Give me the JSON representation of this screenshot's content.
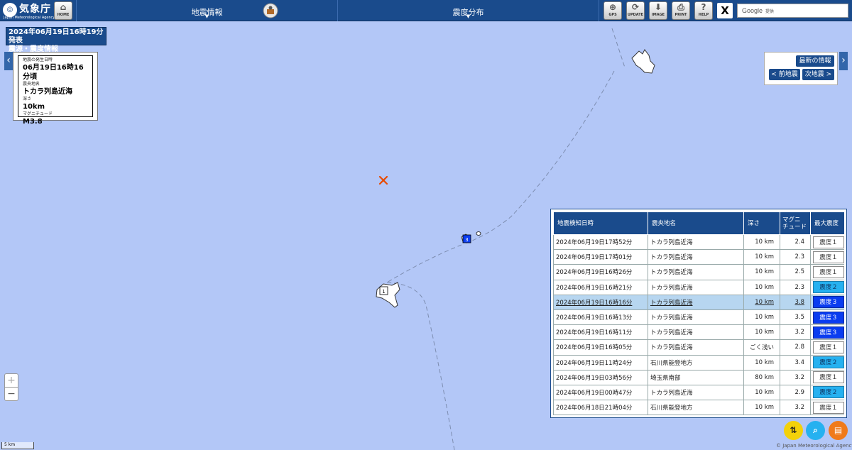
{
  "header": {
    "logo_name": "気象庁",
    "logo_sub": "Japan Meteorological Agency",
    "home_label": "HOME",
    "menu_quake": "地震情報",
    "menu_intensity": "震度分布",
    "tools": [
      "GPS",
      "UPDATE",
      "IMAGE",
      "PRINT",
      "HELP"
    ],
    "x_label": "X",
    "search_brand": "Google",
    "search_provider": "提供"
  },
  "title": {
    "line1": "2024年06月19日16時19分発表",
    "line2": "震源・震度情報"
  },
  "quake": {
    "time_label": "地震の発生日時",
    "time": "06月19日16時16分頃",
    "epicenter_label": "震央地名",
    "epicenter": "トカラ列島近海",
    "depth_label": "深さ",
    "depth": "10km",
    "magnitude_label": "マグニチュード",
    "magnitude": "M3.8"
  },
  "nav": {
    "latest": "最新の情報",
    "prev": "< 前地震",
    "next": "次地震 >"
  },
  "map": {
    "station_3": "3",
    "station_1": "1"
  },
  "zoom": {
    "in": "+",
    "out": "−"
  },
  "scale": "5 km",
  "copyright": "© Japan Meteorological Agency",
  "table": {
    "headers": [
      "地震検知日時",
      "震央地名",
      "深さ",
      "マグニ\nチュード",
      "最大震度"
    ],
    "rows": [
      {
        "time": "2024年06月19日17時52分",
        "place": "トカラ列島近海",
        "depth": "10 km",
        "mag": "2.4",
        "int": "震度１",
        "lvl": 1
      },
      {
        "time": "2024年06月19日17時01分",
        "place": "トカラ列島近海",
        "depth": "10 km",
        "mag": "2.3",
        "int": "震度１",
        "lvl": 1
      },
      {
        "time": "2024年06月19日16時26分",
        "place": "トカラ列島近海",
        "depth": "10 km",
        "mag": "2.5",
        "int": "震度１",
        "lvl": 1
      },
      {
        "time": "2024年06月19日16時21分",
        "place": "トカラ列島近海",
        "depth": "10 km",
        "mag": "2.3",
        "int": "震度２",
        "lvl": 2
      },
      {
        "time": "2024年06月19日16時16分",
        "place": "トカラ列島近海",
        "depth": "10 km",
        "mag": "3.8",
        "int": "震度３",
        "lvl": 3,
        "selected": true
      },
      {
        "time": "2024年06月19日16時13分",
        "place": "トカラ列島近海",
        "depth": "10 km",
        "mag": "3.5",
        "int": "震度３",
        "lvl": 3
      },
      {
        "time": "2024年06月19日16時11分",
        "place": "トカラ列島近海",
        "depth": "10 km",
        "mag": "3.2",
        "int": "震度３",
        "lvl": 3
      },
      {
        "time": "2024年06月19日16時05分",
        "place": "トカラ列島近海",
        "depth": "ごく浅い",
        "mag": "2.8",
        "int": "震度１",
        "lvl": 1
      },
      {
        "time": "2024年06月19日11時24分",
        "place": "石川県能登地方",
        "depth": "10 km",
        "mag": "3.4",
        "int": "震度２",
        "lvl": 2
      },
      {
        "time": "2024年06月19日03時56分",
        "place": "埼玉県南部",
        "depth": "80 km",
        "mag": "3.2",
        "int": "震度１",
        "lvl": 1
      },
      {
        "time": "2024年06月19日00時47分",
        "place": "トカラ列島近海",
        "depth": "10 km",
        "mag": "2.9",
        "int": "震度２",
        "lvl": 2
      },
      {
        "time": "2024年06月18日21時04分",
        "place": "石川県能登地方",
        "depth": "10 km",
        "mag": "3.2",
        "int": "震度１",
        "lvl": 1
      }
    ]
  },
  "colors": {
    "sea": "#b3c7f7",
    "header": "#1a4b8c",
    "intensity_2": "#26b1f0",
    "intensity_3": "#0a3cf0",
    "epicenter": "#e84a00"
  }
}
